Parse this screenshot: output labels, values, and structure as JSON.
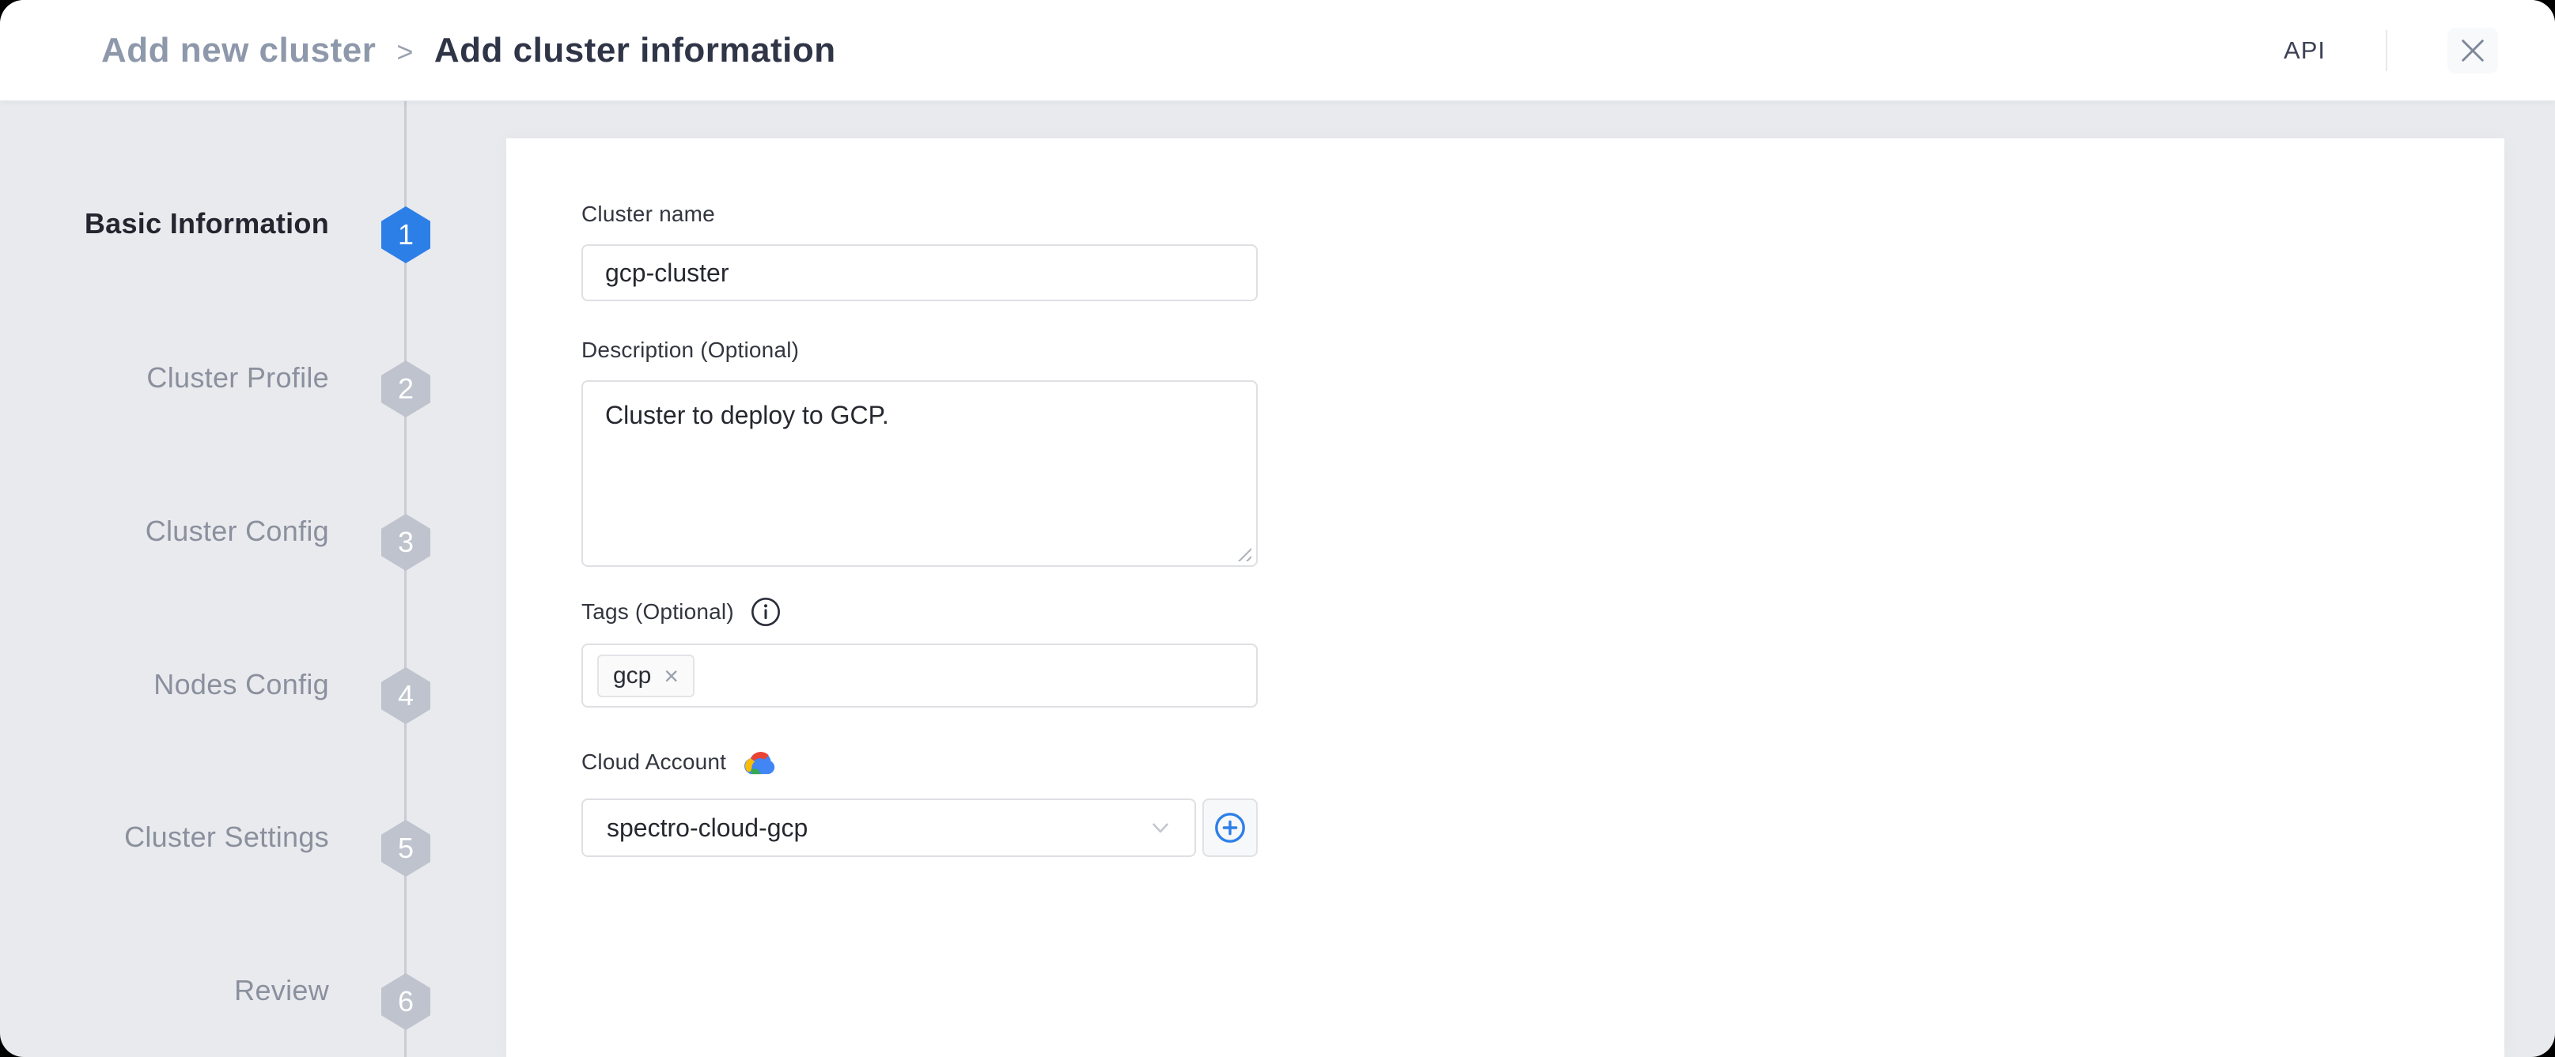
{
  "header": {
    "breadcrumb": {
      "root": "Add new cluster",
      "separator": ">",
      "current": "Add cluster information"
    },
    "api_label": "API"
  },
  "stepper": {
    "steps": [
      {
        "number": "1",
        "label": "Basic Information",
        "active": true
      },
      {
        "number": "2",
        "label": "Cluster Profile",
        "active": false
      },
      {
        "number": "3",
        "label": "Cluster Config",
        "active": false
      },
      {
        "number": "4",
        "label": "Nodes Config",
        "active": false
      },
      {
        "number": "5",
        "label": "Cluster Settings",
        "active": false
      },
      {
        "number": "6",
        "label": "Review",
        "active": false
      }
    ]
  },
  "form": {
    "cluster_name": {
      "label": "Cluster name",
      "value": "gcp-cluster"
    },
    "description": {
      "label": "Description (Optional)",
      "value": "Cluster to deploy to GCP."
    },
    "tags": {
      "label": "Tags (Optional)",
      "chips": [
        {
          "text": "gcp",
          "remove_glyph": "×"
        }
      ]
    },
    "cloud_account": {
      "label": "Cloud Account",
      "selected": "spectro-cloud-gcp"
    }
  },
  "icons": {
    "close": "close-x",
    "info": "circled-i-tooltip",
    "cloud_provider": "google-cloud-logo",
    "chevron": "chevron-down",
    "add": "plus-in-circle",
    "resize": "textarea-resize-grip"
  },
  "colors": {
    "accent_blue": "#2D7FE8",
    "inactive_hex": "#BEC3CD",
    "sidebar_bg": "#E9EAEE",
    "panel_bg": "#FFFFFF",
    "gcp_red": "#EA4335",
    "gcp_yellow": "#FBBC05",
    "gcp_green": "#34A853",
    "gcp_blue": "#4285F4"
  }
}
